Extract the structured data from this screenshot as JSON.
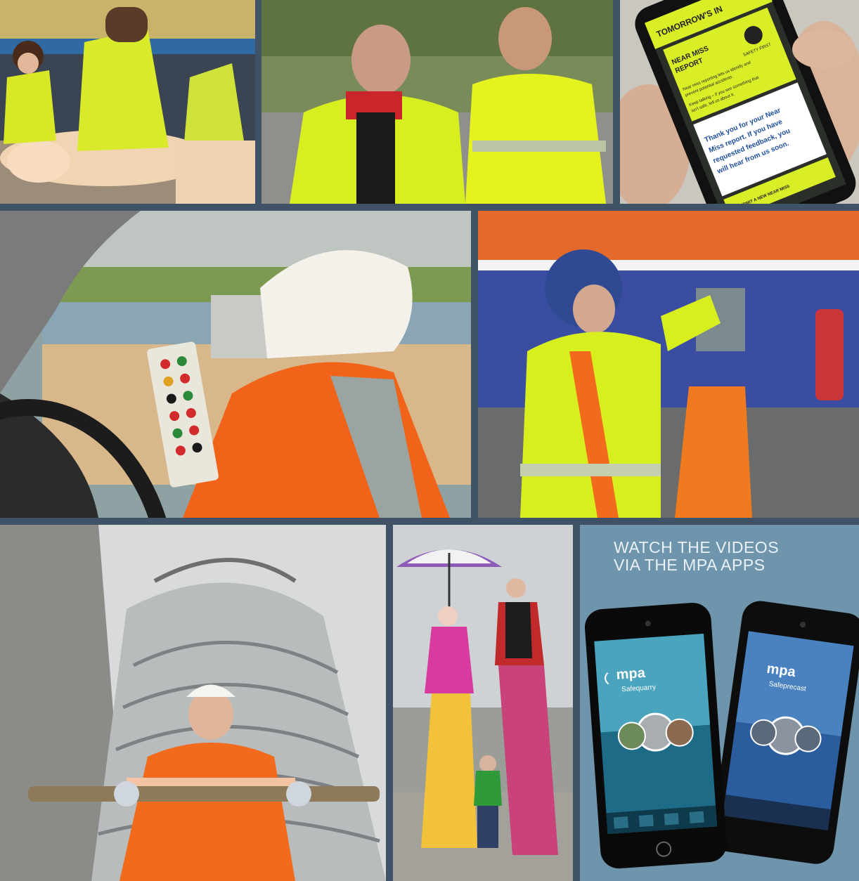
{
  "photos": {
    "cpr_training": "first-aid-cpr-training-photo",
    "workers_talking": "workers-in-hi-vis-talking-photo",
    "near_miss_app": "near-miss-report-phone-photo",
    "dredger_remote": "worker-with-remote-control-photo",
    "train_worker": "worker-at-rail-wagon-photo",
    "silo_worker": "worker-on-silo-scaffold-photo",
    "stilt_walkers": "stilt-walkers-with-child-photo"
  },
  "phone_screen": {
    "header": "TOMORROW'S IN",
    "title_line1": "NEAR MISS",
    "title_line2": "REPORT",
    "badge": "SAFETY FIRST",
    "body_line1": "Near miss reporting lets us identify and",
    "body_line2": "prevent potential accidents.",
    "body_line3": "Keep talking – if you see something that",
    "body_line4": "isn't safe, tell us about it.",
    "thanks_line1": "Thank you for your Near",
    "thanks_line2": "Miss report. If you have",
    "thanks_line3": "requested feedback, you",
    "thanks_line4": "will hear from us soon.",
    "submit": "SUBMIT A NEW NEAR MISS"
  },
  "apps_panel": {
    "heading_line1": "WATCH THE VIDEOS",
    "heading_line2": "VIA THE MPA APPS",
    "app1_logo": "mpa",
    "app1_name": "Safequarry",
    "app2_logo": "mpa",
    "app2_name": "Safeprecast"
  },
  "colors": {
    "frame": "#3f5266",
    "panel": "#6f95ad",
    "hivis_yellow": "#d8ef1f",
    "hivis_orange": "#f26a1b"
  }
}
